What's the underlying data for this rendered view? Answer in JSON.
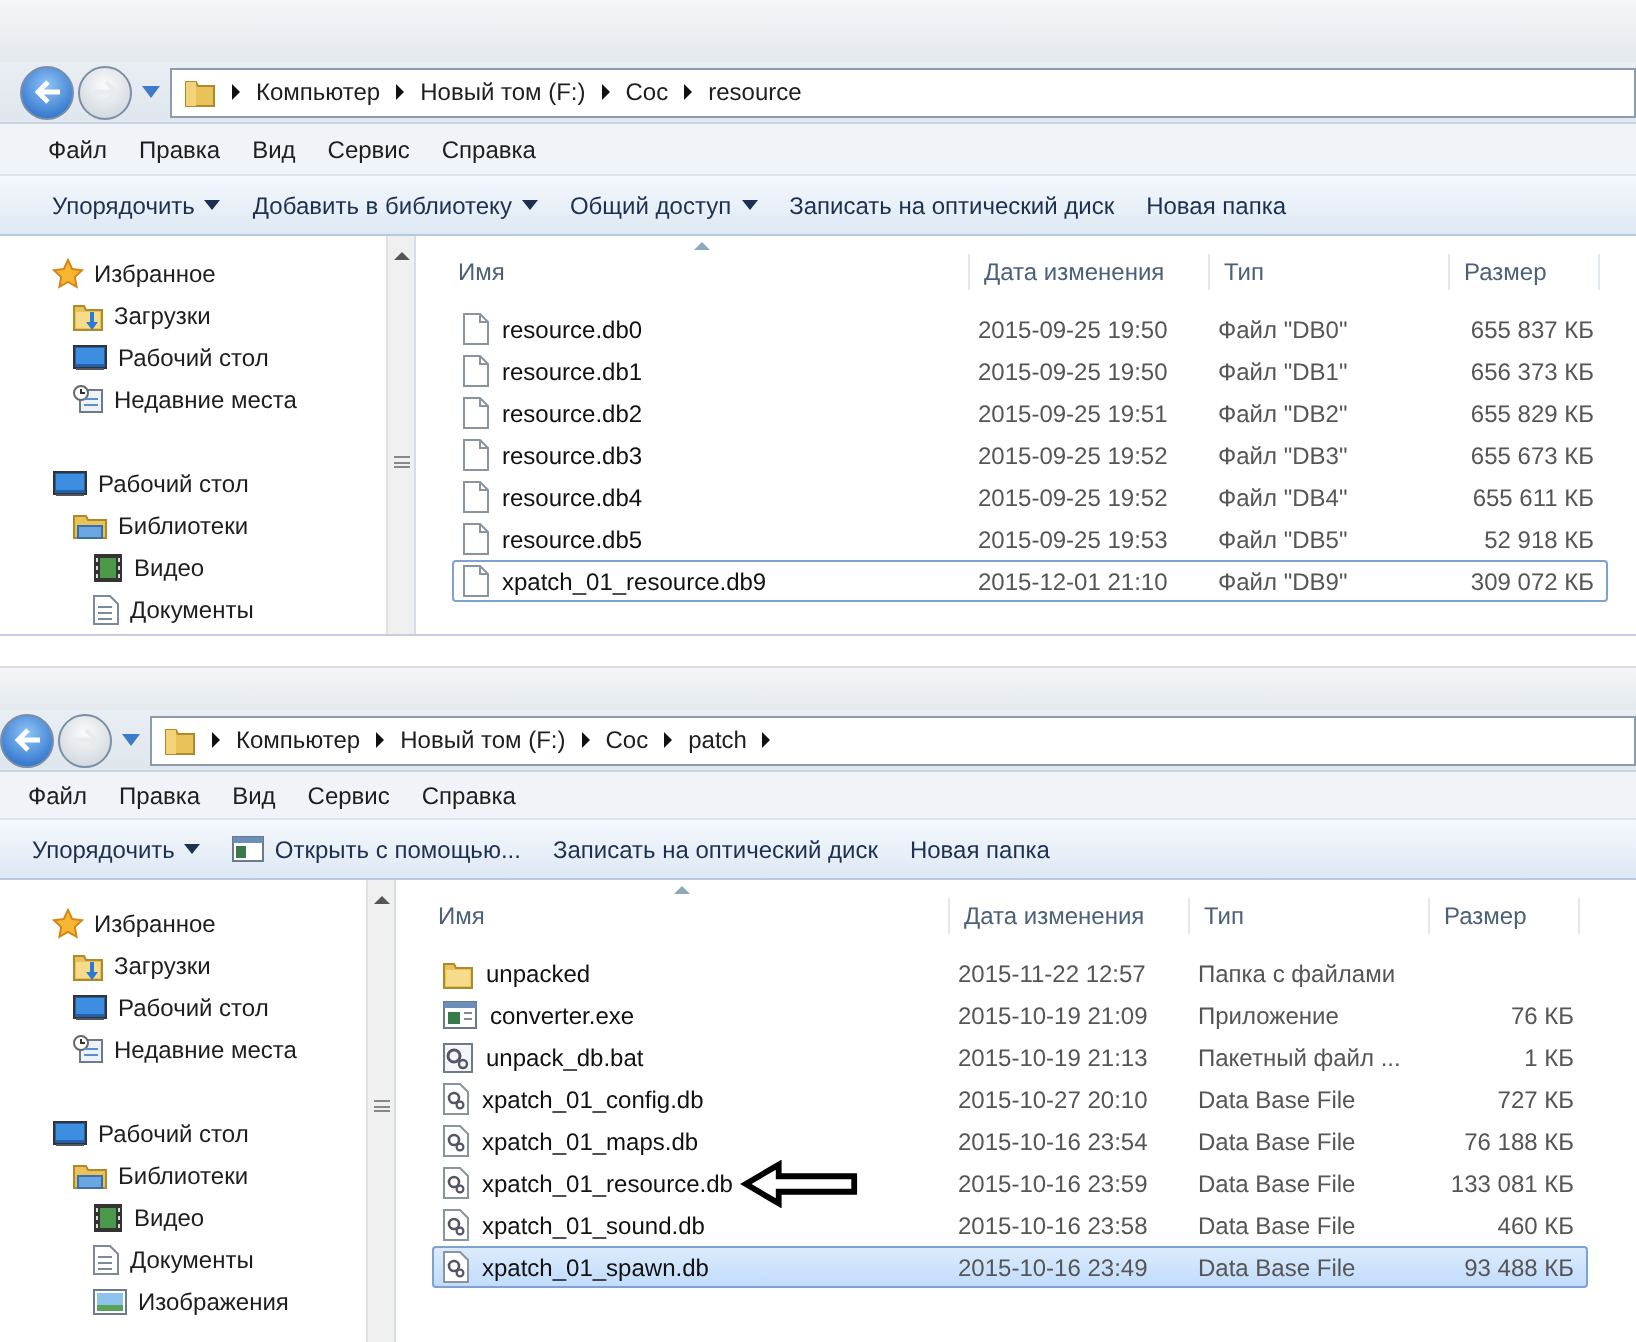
{
  "windows": [
    {
      "breadcrumb": [
        "Компьютер",
        "Новый том (F:)",
        "Coc",
        "resource"
      ],
      "breadcrumb_trailing_arrow": false,
      "menu": [
        "Файл",
        "Правка",
        "Вид",
        "Сервис",
        "Справка"
      ],
      "commands": [
        {
          "label": "Упорядочить",
          "dropdown": true,
          "kind": "plain"
        },
        {
          "label": "Добавить в библиотеку",
          "dropdown": true,
          "kind": "plain"
        },
        {
          "label": "Общий доступ",
          "dropdown": true,
          "kind": "plain"
        },
        {
          "label": "Записать на оптический диск",
          "dropdown": false,
          "kind": "plain"
        },
        {
          "label": "Новая папка",
          "dropdown": false,
          "kind": "plain"
        }
      ],
      "nav": [
        {
          "label": "Избранное",
          "kind": "star",
          "children": [
            {
              "label": "Загрузки",
              "kind": "downloads"
            },
            {
              "label": "Рабочий стол",
              "kind": "desktop"
            },
            {
              "label": "Недавние места",
              "kind": "recent"
            }
          ]
        },
        {
          "label": "Рабочий стол",
          "kind": "desktop",
          "children": [
            {
              "label": "Библиотеки",
              "kind": "library",
              "children": [
                {
                  "label": "Видео",
                  "kind": "video"
                },
                {
                  "label": "Документы",
                  "kind": "document"
                }
              ]
            }
          ]
        }
      ],
      "columns": [
        "Имя",
        "Дата изменения",
        "Тип",
        "Размер"
      ],
      "rows": [
        {
          "name": "resource.db0",
          "date": "2015-09-25 19:50",
          "type": "Файл \"DB0\"",
          "size": "655 837 КБ",
          "kind": "file",
          "selected": false,
          "focused": false,
          "annotated": false
        },
        {
          "name": "resource.db1",
          "date": "2015-09-25 19:50",
          "type": "Файл \"DB1\"",
          "size": "656 373 КБ",
          "kind": "file",
          "selected": false,
          "focused": false,
          "annotated": false
        },
        {
          "name": "resource.db2",
          "date": "2015-09-25 19:51",
          "type": "Файл \"DB2\"",
          "size": "655 829 КБ",
          "kind": "file",
          "selected": false,
          "focused": false,
          "annotated": false
        },
        {
          "name": "resource.db3",
          "date": "2015-09-25 19:52",
          "type": "Файл \"DB3\"",
          "size": "655 673 КБ",
          "kind": "file",
          "selected": false,
          "focused": false,
          "annotated": false
        },
        {
          "name": "resource.db4",
          "date": "2015-09-25 19:52",
          "type": "Файл \"DB4\"",
          "size": "655 611 КБ",
          "kind": "file",
          "selected": false,
          "focused": false,
          "annotated": false
        },
        {
          "name": "resource.db5",
          "date": "2015-09-25 19:53",
          "type": "Файл \"DB5\"",
          "size": "52 918 КБ",
          "kind": "file",
          "selected": false,
          "focused": false,
          "annotated": false
        },
        {
          "name": "xpatch_01_resource.db9",
          "date": "2015-12-01 21:10",
          "type": "Файл \"DB9\"",
          "size": "309 072 КБ",
          "kind": "file",
          "selected": false,
          "focused": true,
          "annotated": false
        }
      ]
    },
    {
      "breadcrumb": [
        "Компьютер",
        "Новый том (F:)",
        "Coc",
        "patch"
      ],
      "breadcrumb_trailing_arrow": true,
      "menu": [
        "Файл",
        "Правка",
        "Вид",
        "Сервис",
        "Справка"
      ],
      "commands": [
        {
          "label": "Упорядочить",
          "dropdown": true,
          "kind": "plain"
        },
        {
          "label": "Открыть с помощью...",
          "dropdown": false,
          "kind": "app"
        },
        {
          "label": "Записать на оптический диск",
          "dropdown": false,
          "kind": "plain"
        },
        {
          "label": "Новая папка",
          "dropdown": false,
          "kind": "plain"
        }
      ],
      "nav": [
        {
          "label": "Избранное",
          "kind": "star",
          "children": [
            {
              "label": "Загрузки",
              "kind": "downloads"
            },
            {
              "label": "Рабочий стол",
              "kind": "desktop"
            },
            {
              "label": "Недавние места",
              "kind": "recent"
            }
          ]
        },
        {
          "label": "Рабочий стол",
          "kind": "desktop",
          "children": [
            {
              "label": "Библиотеки",
              "kind": "library",
              "children": [
                {
                  "label": "Видео",
                  "kind": "video"
                },
                {
                  "label": "Документы",
                  "kind": "document"
                },
                {
                  "label": "Изображения",
                  "kind": "pictures"
                }
              ]
            }
          ]
        }
      ],
      "columns": [
        "Имя",
        "Дата изменения",
        "Тип",
        "Размер"
      ],
      "rows": [
        {
          "name": "unpacked",
          "date": "2015-11-22 12:57",
          "type": "Папка с файлами",
          "size": "",
          "kind": "folder",
          "selected": false,
          "focused": false,
          "annotated": false
        },
        {
          "name": "converter.exe",
          "date": "2015-10-19 21:09",
          "type": "Приложение",
          "size": "76 КБ",
          "kind": "exe",
          "selected": false,
          "focused": false,
          "annotated": false
        },
        {
          "name": "unpack_db.bat",
          "date": "2015-10-19 21:13",
          "type": "Пакетный файл ...",
          "size": "1 КБ",
          "kind": "bat",
          "selected": false,
          "focused": false,
          "annotated": false
        },
        {
          "name": "xpatch_01_config.db",
          "date": "2015-10-27 20:10",
          "type": "Data Base File",
          "size": "727 КБ",
          "kind": "db",
          "selected": false,
          "focused": false,
          "annotated": false
        },
        {
          "name": "xpatch_01_maps.db",
          "date": "2015-10-16 23:54",
          "type": "Data Base File",
          "size": "76 188 КБ",
          "kind": "db",
          "selected": false,
          "focused": false,
          "annotated": false
        },
        {
          "name": "xpatch_01_resource.db",
          "date": "2015-10-16 23:59",
          "type": "Data Base File",
          "size": "133 081 КБ",
          "kind": "db",
          "selected": false,
          "focused": false,
          "annotated": true
        },
        {
          "name": "xpatch_01_sound.db",
          "date": "2015-10-16 23:58",
          "type": "Data Base File",
          "size": "460 КБ",
          "kind": "db",
          "selected": false,
          "focused": false,
          "annotated": false
        },
        {
          "name": "xpatch_01_spawn.db",
          "date": "2015-10-16 23:49",
          "type": "Data Base File",
          "size": "93 488 КБ",
          "kind": "db",
          "selected": true,
          "focused": true,
          "annotated": false
        }
      ]
    }
  ]
}
